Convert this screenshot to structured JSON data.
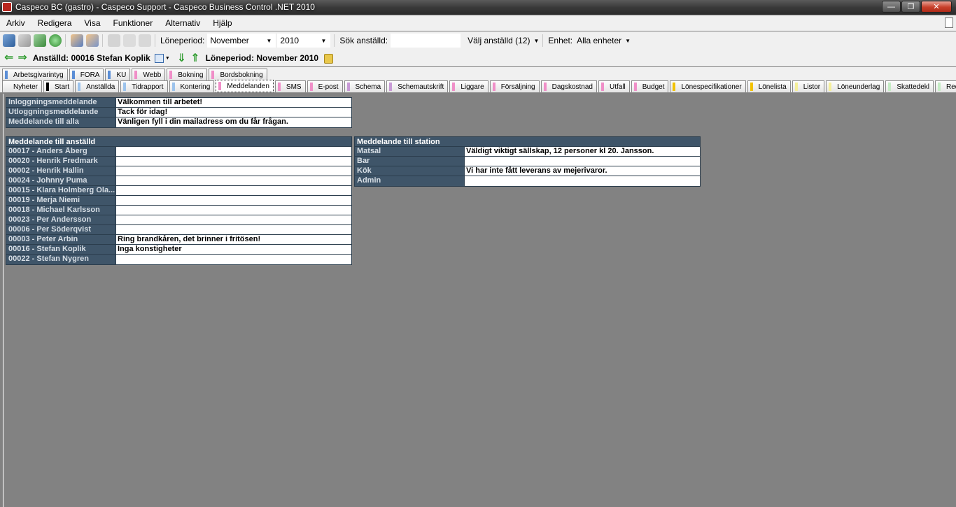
{
  "window": {
    "title": "Caspeco BC (gastro) - Caspeco Support - Caspeco Business Control .NET 2010"
  },
  "menu": [
    "Arkiv",
    "Redigera",
    "Visa",
    "Funktioner",
    "Alternativ",
    "Hjälp"
  ],
  "toolbar": {
    "loneperiod_label": "Löneperiod:",
    "month": "November",
    "year": "2010",
    "search_label": "Sök anställd:",
    "search_value": "",
    "select_employee": "Välj anställd (12)",
    "unit_label": "Enhet:",
    "unit_value": "Alla enheter"
  },
  "nav": {
    "employee": "Anställd: 00016 Stefan Koplik",
    "period": "Löneperiod: November 2010"
  },
  "tabs_row1": [
    {
      "label": "Arbetsgivarintyg",
      "color": "#5b8ed6"
    },
    {
      "label": "FORA",
      "color": "#5b8ed6"
    },
    {
      "label": "KU",
      "color": "#5b8ed6"
    },
    {
      "label": "Webb",
      "color": "#f08fc8"
    },
    {
      "label": "Bokning",
      "color": "#f08fc8"
    },
    {
      "label": "Bordsbokning",
      "color": "#f08fc8"
    }
  ],
  "tabs_row2": [
    {
      "label": "Nyheter",
      "color": ""
    },
    {
      "label": "Start",
      "color": "#000000"
    },
    {
      "label": "Anställda",
      "color": "#9cc3ec"
    },
    {
      "label": "Tidrapport",
      "color": "#9cc3ec"
    },
    {
      "label": "Kontering",
      "color": "#9cc3ec"
    },
    {
      "label": "Meddelanden",
      "color": "#f08fc8",
      "active": true
    },
    {
      "label": "SMS",
      "color": "#f08fc8"
    },
    {
      "label": "E-post",
      "color": "#f08fc8"
    },
    {
      "label": "Schema",
      "color": "#c89ad6"
    },
    {
      "label": "Schemautskrift",
      "color": "#c89ad6"
    },
    {
      "label": "Liggare",
      "color": "#f08fc8"
    },
    {
      "label": "Försäljning",
      "color": "#f08fc8"
    },
    {
      "label": "Dagskostnad",
      "color": "#f08fc8"
    },
    {
      "label": "Utfall",
      "color": "#f08fc8"
    },
    {
      "label": "Budget",
      "color": "#f08fc8"
    },
    {
      "label": "Lönespecifikationer",
      "color": "#f2c200"
    },
    {
      "label": "Lönelista",
      "color": "#f2c200"
    },
    {
      "label": "Listor",
      "color": "#f5ef9a"
    },
    {
      "label": "Löneunderlag",
      "color": "#f5ef9a"
    },
    {
      "label": "Skattedekl",
      "color": "#c5ecc5"
    },
    {
      "label": "Redovisning",
      "color": "#c5ecc5"
    }
  ],
  "general_messages": [
    {
      "label": "Inloggningsmeddelande",
      "value": "Välkommen till arbetet!"
    },
    {
      "label": "Utloggningsmeddelande",
      "value": "Tack för idag!"
    },
    {
      "label": "Meddelande till alla",
      "value": "Vänligen fyll i din mailadress om du får frågan."
    }
  ],
  "employee_messages": {
    "header": "Meddelande till anställd",
    "rows": [
      {
        "label": "00017 - Anders Åberg",
        "value": ""
      },
      {
        "label": "00020 - Henrik Fredmark",
        "value": ""
      },
      {
        "label": "00002 - Henrik Hallin",
        "value": ""
      },
      {
        "label": "00024 - Johnny Puma",
        "value": ""
      },
      {
        "label": "00015 - Klara Holmberg Ola...",
        "value": ""
      },
      {
        "label": "00019 - Merja Niemi",
        "value": ""
      },
      {
        "label": "00018 - Michael Karlsson",
        "value": ""
      },
      {
        "label": "00023 - Per Andersson",
        "value": ""
      },
      {
        "label": "00006 - Per Söderqvist",
        "value": ""
      },
      {
        "label": "00003 - Peter Arbin",
        "value": "Ring brandkåren, det brinner i fritösen!"
      },
      {
        "label": "00016 - Stefan Koplik",
        "value": "Inga konstigheter"
      },
      {
        "label": "00022 - Stefan Nygren",
        "value": ""
      }
    ]
  },
  "station_messages": {
    "header": "Meddelande till station",
    "rows": [
      {
        "label": "Matsal",
        "value": "Väldigt viktigt sällskap, 12 personer kl 20. Jansson."
      },
      {
        "label": "Bar",
        "value": ""
      },
      {
        "label": "Kök",
        "value": "Vi har inte fått leverans av mejerivaror."
      },
      {
        "label": "Admin",
        "value": ""
      }
    ]
  }
}
